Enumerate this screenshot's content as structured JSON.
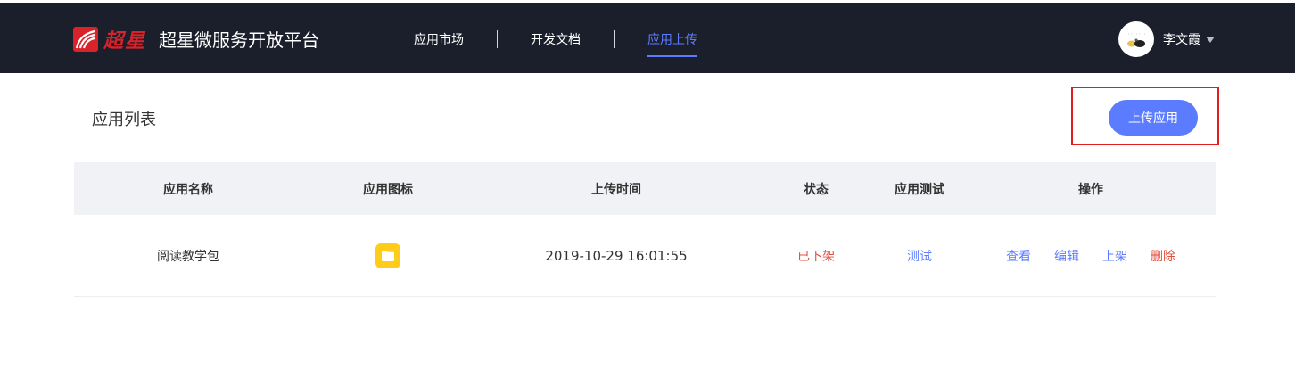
{
  "header": {
    "brand_logo_text": "超星",
    "platform_title": "超星微服务开放平台",
    "nav": [
      {
        "label": "应用市场",
        "active": false
      },
      {
        "label": "开发文档",
        "active": false
      },
      {
        "label": "应用上传",
        "active": true
      }
    ],
    "user": {
      "name": "李文霞"
    }
  },
  "main": {
    "section_title": "应用列表",
    "upload_button_label": "上传应用",
    "table": {
      "columns": [
        "应用名称",
        "应用图标",
        "上传时间",
        "状态",
        "应用测试",
        "操作"
      ],
      "rows": [
        {
          "name": "阅读教学包",
          "icon": "folder-icon",
          "upload_time": "2019-10-29 16:01:55",
          "status": "已下架",
          "test_label": "测试",
          "actions": {
            "view": "查看",
            "edit": "编辑",
            "publish": "上架",
            "delete": "删除"
          }
        }
      ]
    }
  },
  "colors": {
    "header_bg": "#1b1e2b",
    "accent": "#5b7cff",
    "danger": "#e34f3e",
    "table_header_bg": "#f1f2f5",
    "highlight_border": "#e31d1d",
    "icon_yellow": "#ffcc1a"
  }
}
